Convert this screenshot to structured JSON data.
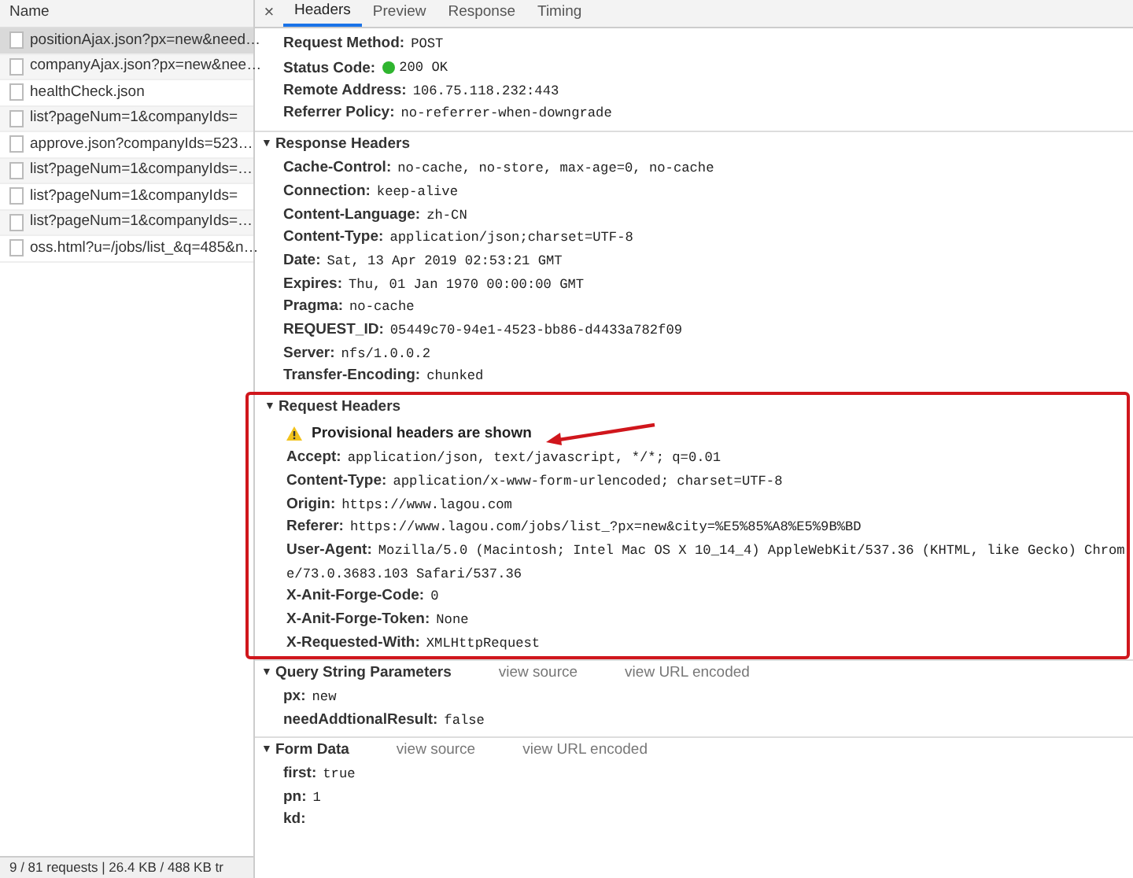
{
  "requests_panel": {
    "header": "Name",
    "requests": [
      {
        "name": "positionAjax.json?px=new&need…",
        "selected": true
      },
      {
        "name": "companyAjax.json?px=new&nee…",
        "selected": false
      },
      {
        "name": "healthCheck.json",
        "selected": false
      },
      {
        "name": "list?pageNum=1&companyIds=",
        "selected": false
      },
      {
        "name": "approve.json?companyIds=523…",
        "selected": false
      },
      {
        "name": "list?pageNum=1&companyIds=…",
        "selected": false
      },
      {
        "name": "list?pageNum=1&companyIds=",
        "selected": false
      },
      {
        "name": "list?pageNum=1&companyIds=…",
        "selected": false
      },
      {
        "name": "oss.html?u=/jobs/list_&q=485&n…",
        "selected": false
      }
    ],
    "status_bar": "9 / 81 requests | 26.4 KB / 488 KB tr"
  },
  "detail": {
    "close": "×",
    "tabs": [
      {
        "label": "Headers",
        "selected": true
      },
      {
        "label": "Preview",
        "selected": false
      },
      {
        "label": "Response",
        "selected": false
      },
      {
        "label": "Timing",
        "selected": false
      }
    ],
    "sections": [
      {
        "rows": [
          {
            "kind": "header",
            "name": "Request Method:",
            "value": "POST"
          },
          {
            "kind": "status",
            "name": "Status Code:",
            "value": "200 OK",
            "color": "#2fb52f"
          },
          {
            "kind": "header",
            "name": "Remote Address:",
            "value": "106.75.118.232:443"
          },
          {
            "kind": "header",
            "name": "Referrer Policy:",
            "value": "no-referrer-when-downgrade"
          }
        ]
      },
      {
        "toggle": "▼",
        "title": "Response Headers",
        "expanded": true,
        "highlighted": false,
        "rows": [
          {
            "kind": "header",
            "name": "Cache-Control:",
            "value": "no-cache, no-store, max-age=0, no-cache"
          },
          {
            "kind": "header",
            "name": "Connection:",
            "value": "keep-alive"
          },
          {
            "kind": "header",
            "name": "Content-Language:",
            "value": "zh-CN"
          },
          {
            "kind": "header",
            "name": "Content-Type:",
            "value": "application/json;charset=UTF-8"
          },
          {
            "kind": "header",
            "name": "Date:",
            "value": "Sat, 13 Apr 2019 02:53:21 GMT"
          },
          {
            "kind": "header",
            "name": "Expires:",
            "value": "Thu, 01 Jan 1970 00:00:00 GMT"
          },
          {
            "kind": "header",
            "name": "Pragma:",
            "value": "no-cache"
          },
          {
            "kind": "header",
            "name": "REQUEST_ID:",
            "value": "05449c70-94e1-4523-bb86-d4433a782f09"
          },
          {
            "kind": "header",
            "name": "Server:",
            "value": "nfs/1.0.0.2"
          },
          {
            "kind": "header",
            "name": "Transfer-Encoding:",
            "value": "chunked"
          }
        ]
      },
      {
        "toggle": "▼",
        "title": "Request Headers",
        "expanded": true,
        "highlighted": true,
        "rows": [
          {
            "kind": "warning",
            "name": "Provisional headers are shown",
            "arrow": true
          },
          {
            "kind": "header",
            "name": "Accept:",
            "value": "application/json, text/javascript, */*; q=0.01"
          },
          {
            "kind": "header",
            "name": "Content-Type:",
            "value": "application/x-www-form-urlencoded; charset=UTF-8"
          },
          {
            "kind": "header",
            "name": "Origin:",
            "value": "https://www.lagou.com"
          },
          {
            "kind": "header",
            "name": "Referer:",
            "value": "https://www.lagou.com/jobs/list_?px=new&city=%E5%85%A8%E5%9B%BD"
          },
          {
            "kind": "header",
            "name": "User-Agent:",
            "value": "Mozilla/5.0 (Macintosh; Intel Mac OS X 10_14_4) AppleWebKit/537.36 (KHTML, like Gecko) Chrome/73.0.3683.103 Safari/537.36"
          },
          {
            "kind": "header",
            "name": "X-Anit-Forge-Code:",
            "value": "0"
          },
          {
            "kind": "header",
            "name": "X-Anit-Forge-Token:",
            "value": "None"
          },
          {
            "kind": "header",
            "name": "X-Requested-With:",
            "value": "XMLHttpRequest"
          }
        ]
      },
      {
        "toggle": "▼",
        "title": "Query String Parameters",
        "expanded": true,
        "highlighted": false,
        "links": [
          "view source",
          "view URL encoded"
        ],
        "rows": [
          {
            "kind": "header",
            "name": "px:",
            "value": "new"
          },
          {
            "kind": "header",
            "name": "needAddtionalResult:",
            "value": "false"
          }
        ]
      },
      {
        "toggle": "▼",
        "title": "Form Data",
        "expanded": true,
        "highlighted": false,
        "links": [
          "view source",
          "view URL encoded"
        ],
        "rows": [
          {
            "kind": "header",
            "name": "first:",
            "value": "true"
          },
          {
            "kind": "header",
            "name": "pn:",
            "value": "1"
          },
          {
            "kind": "header",
            "name": "kd:"
          }
        ]
      }
    ]
  }
}
